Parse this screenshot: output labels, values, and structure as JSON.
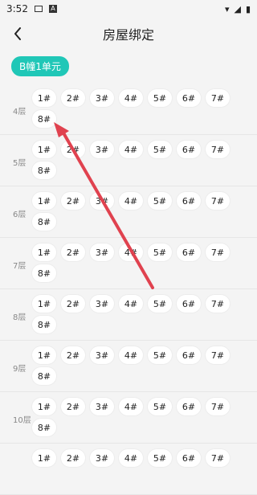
{
  "status": {
    "time": "3:52"
  },
  "header": {
    "title": "房屋绑定"
  },
  "building_chip": "B幢1单元",
  "floors": [
    {
      "label": "4层",
      "rooms": [
        "1#",
        "2#",
        "3#",
        "4#",
        "5#",
        "6#",
        "7#",
        "8#"
      ]
    },
    {
      "label": "5层",
      "rooms": [
        "1#",
        "2#",
        "3#",
        "4#",
        "5#",
        "6#",
        "7#",
        "8#"
      ]
    },
    {
      "label": "6层",
      "rooms": [
        "1#",
        "2#",
        "3#",
        "4#",
        "5#",
        "6#",
        "7#",
        "8#"
      ]
    },
    {
      "label": "7层",
      "rooms": [
        "1#",
        "2#",
        "3#",
        "4#",
        "5#",
        "6#",
        "7#",
        "8#"
      ]
    },
    {
      "label": "8层",
      "rooms": [
        "1#",
        "2#",
        "3#",
        "4#",
        "5#",
        "6#",
        "7#",
        "8#"
      ]
    },
    {
      "label": "9层",
      "rooms": [
        "1#",
        "2#",
        "3#",
        "4#",
        "5#",
        "6#",
        "7#",
        "8#"
      ]
    },
    {
      "label": "10层",
      "rooms": [
        "1#",
        "2#",
        "3#",
        "4#",
        "5#",
        "6#",
        "7#",
        "8#"
      ]
    },
    {
      "label": "",
      "rooms": [
        "1#",
        "2#",
        "3#",
        "4#",
        "5#",
        "6#",
        "7#"
      ]
    }
  ],
  "colors": {
    "accent": "#20c7b7",
    "arrow": "#e0424f",
    "background": "#f4f4f4"
  }
}
